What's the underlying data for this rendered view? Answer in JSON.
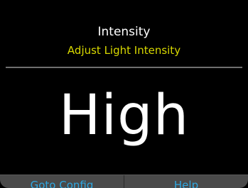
{
  "colors": {
    "background": "#000000",
    "title": "#ffffff",
    "accent_subtitle": "#d8d800",
    "value": "#ffffff",
    "bottom_bar": "#4a4a4a",
    "bottom_bar_text": "#2fa7e0"
  },
  "header": {
    "title": "Intensity",
    "subtitle": "Adjust Light Intensity"
  },
  "main": {
    "value": "High"
  },
  "bottom_bar": {
    "left_label": "Goto Config",
    "right_label": "Help"
  }
}
